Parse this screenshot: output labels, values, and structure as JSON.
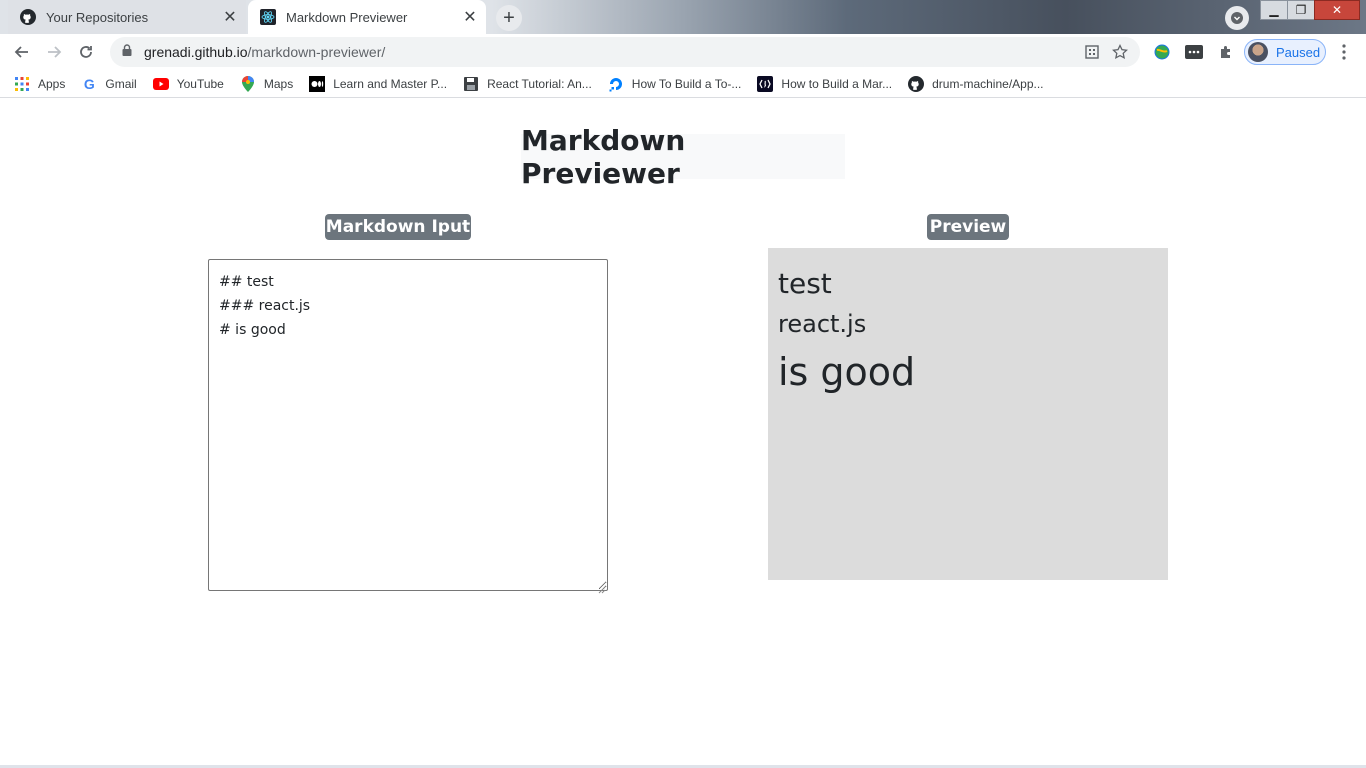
{
  "tabs": [
    {
      "title": "Your Repositories",
      "active": false,
      "favicon": "github-icon"
    },
    {
      "title": "Markdown Previewer",
      "active": true,
      "favicon": "react-icon"
    }
  ],
  "window_controls": {
    "status": "Paused"
  },
  "address_bar": {
    "host": "grenadi.github.io",
    "path": "/markdown-previewer/"
  },
  "bookmarks": [
    {
      "label": "Apps",
      "icon": "apps-grid-icon"
    },
    {
      "label": "Gmail",
      "icon": "google-icon"
    },
    {
      "label": "YouTube",
      "icon": "youtube-icon"
    },
    {
      "label": "Maps",
      "icon": "maps-pin-icon"
    },
    {
      "label": "Learn and Master P...",
      "icon": "medium-icon"
    },
    {
      "label": "React Tutorial: An...",
      "icon": "floppy-icon"
    },
    {
      "label": "How To Build a To-...",
      "icon": "digitalocean-icon"
    },
    {
      "label": "How to Build a Mar...",
      "icon": "freecodecamp-icon"
    },
    {
      "label": "drum-machine/App...",
      "icon": "github-icon"
    }
  ],
  "page": {
    "title": "Markdown Previewer",
    "input_label": "Markdown Iput",
    "preview_label": "Preview",
    "editor_value": "## test\n### react.js\n# is good",
    "preview": {
      "h2": "test",
      "h3": "react.js",
      "h1": "is good"
    }
  },
  "colors": {
    "badge": "#6c757d",
    "preview_bg": "#dcdcdc",
    "title_bg": "#f8f9fa"
  }
}
